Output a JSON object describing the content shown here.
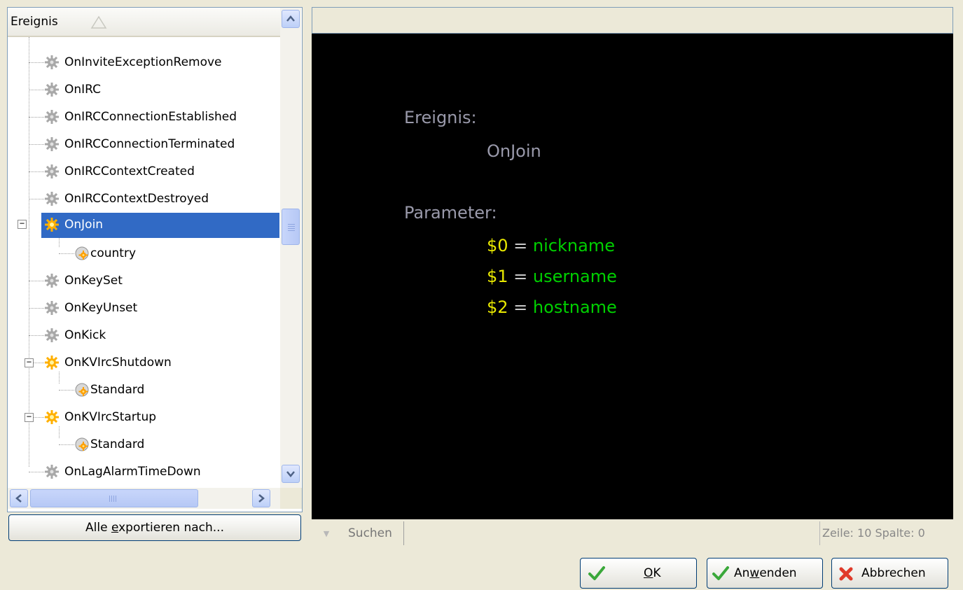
{
  "tree": {
    "header_label": "Ereignis",
    "items": [
      {
        "label": "OnInviteExceptionRemove",
        "icon": "gear-icon"
      },
      {
        "label": "OnIRC",
        "icon": "gear-icon"
      },
      {
        "label": "OnIRCConnectionEstablished",
        "icon": "gear-icon"
      },
      {
        "label": "OnIRCConnectionTerminated",
        "icon": "gear-icon"
      },
      {
        "label": "OnIRCContextCreated",
        "icon": "gear-icon"
      },
      {
        "label": "OnIRCContextDestroyed",
        "icon": "gear-icon"
      },
      {
        "label": "OnJoin",
        "icon": "active-gear-icon",
        "selected": true,
        "expanded": true
      },
      {
        "label": "country",
        "icon": "handler-icon"
      },
      {
        "label": "OnKeySet",
        "icon": "gear-icon"
      },
      {
        "label": "OnKeyUnset",
        "icon": "gear-icon"
      },
      {
        "label": "OnKick",
        "icon": "gear-icon"
      },
      {
        "label": "OnKVIrcShutdown",
        "icon": "active-gear-icon",
        "expanded": true
      },
      {
        "label": "Standard",
        "icon": "handler-icon"
      },
      {
        "label": "OnKVIrcStartup",
        "icon": "active-gear-icon",
        "expanded": true
      },
      {
        "label": "Standard",
        "icon": "handler-icon"
      },
      {
        "label": "OnLagAlarmTimeDown",
        "icon": "gear-icon"
      }
    ]
  },
  "export_button": {
    "pre": "Alle ",
    "accel": "e",
    "post": "xportieren nach..."
  },
  "editor": {
    "event_heading": "Ereignis:",
    "event_name": "OnJoin",
    "param_heading": "Parameter:",
    "params": [
      {
        "var": "$0",
        "eq": " = ",
        "name": "nickname"
      },
      {
        "var": "$1",
        "eq": " = ",
        "name": "username"
      },
      {
        "var": "$2",
        "eq": " = ",
        "name": "hostname"
      }
    ],
    "colors": {
      "background": "#000000",
      "heading": "#9a9aab",
      "variable": "#e8e800",
      "name": "#00d000"
    }
  },
  "search": {
    "label": "Suchen",
    "value": "",
    "position": "Zeile: 10 Spalte: 0"
  },
  "buttons": {
    "ok": {
      "accel": "O",
      "post": "K"
    },
    "apply": {
      "pre": "An",
      "accel": "w",
      "post": "enden"
    },
    "cancel": {
      "label": "Abbrechen"
    }
  },
  "colors": {
    "window": "#ece9d8",
    "selection": "#316ac5",
    "border": "#7f9db9"
  }
}
